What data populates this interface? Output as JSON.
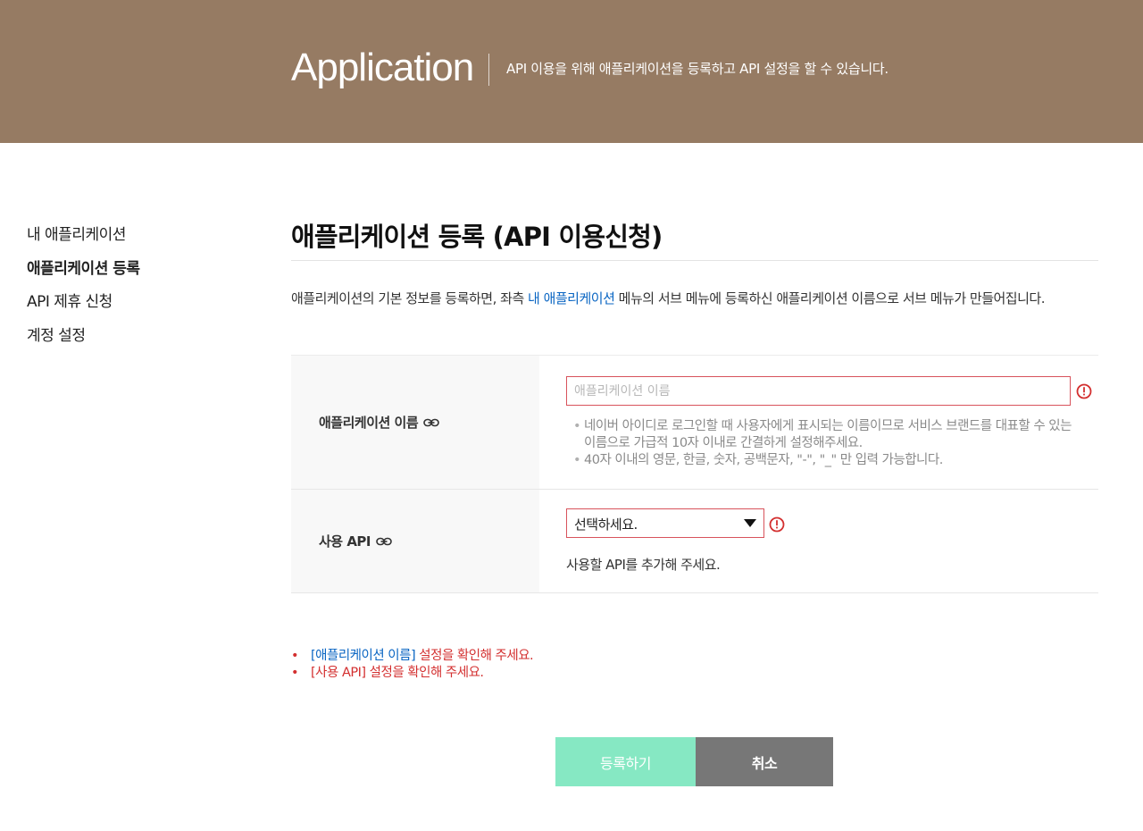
{
  "header": {
    "title": "Application",
    "description": "API 이용을 위해 애플리케이션을 등록하고 API 설정을 할 수 있습니다.",
    "bg_color": "#967b63"
  },
  "sidebar": {
    "items": [
      {
        "label": "내 애플리케이션",
        "active": false
      },
      {
        "label": "애플리케이션 등록",
        "active": true
      },
      {
        "label": "API 제휴 신청",
        "active": false
      },
      {
        "label": "계정 설정",
        "active": false
      }
    ]
  },
  "main": {
    "title": "애플리케이션 등록 (API 이용신청)",
    "intro_before": "애플리케이션의 기본 정보를 등록하면, 좌측 ",
    "intro_link": "내 애플리케이션",
    "intro_after": " 메뉴의 서브 메뉴에 등록하신 애플리케이션 이름으로 서브 메뉴가 만들어집니다.",
    "link_color": "#0b66c3"
  },
  "form": {
    "app_name": {
      "label": "애플리케이션 이름",
      "value": "",
      "placeholder": "애플리케이션 이름",
      "hints": [
        "네이버 아이디로 로그인할 때 사용자에게 표시되는 이름이므로 서비스 브랜드를 대표할 수 있는 이름으로 가급적 10자 이내로 간결하게 설정해주세요.",
        "40자 이내의 영문, 한글, 숫자, 공백문자, \"-\", \"_\" 만 입력 가능합니다."
      ]
    },
    "api": {
      "label": "사용 API",
      "selected": "선택하세요.",
      "note": "사용할 API를 추가해 주세요."
    },
    "error_color": "#d8535c"
  },
  "errors": [
    {
      "link": "[애플리케이션 이름]",
      "text": " 설정을 확인해 주세요."
    },
    {
      "link": "",
      "text": "[사용 API]  설정을 확인해 주세요."
    }
  ],
  "buttons": {
    "submit": "등록하기",
    "cancel": "취소",
    "submit_color": "#86e8c3",
    "cancel_color": "#777777"
  }
}
